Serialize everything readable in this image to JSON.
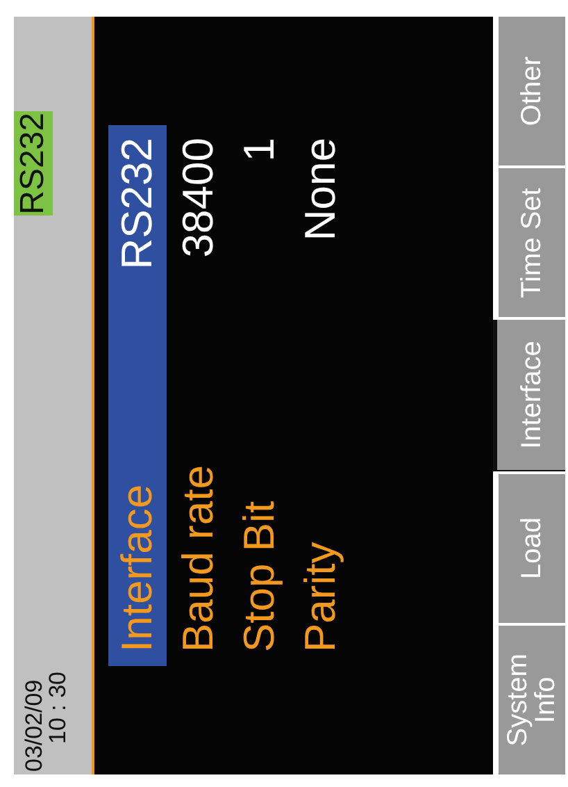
{
  "status": {
    "date": "03/02/09",
    "time": "10 : 30",
    "badge": "RS232"
  },
  "settings": [
    {
      "label": "Interface",
      "value": "RS232",
      "selected": true
    },
    {
      "label": "Baud rate",
      "value": "38400",
      "selected": false
    },
    {
      "label": "Stop Bit",
      "value": "1",
      "selected": false
    },
    {
      "label": "Parity",
      "value": "None",
      "selected": false
    }
  ],
  "tabs": [
    {
      "label": "System Info",
      "selected": false
    },
    {
      "label": "Load",
      "selected": false
    },
    {
      "label": "Interface",
      "selected": true
    },
    {
      "label": "Time Set",
      "selected": false
    },
    {
      "label": "Other",
      "selected": false
    }
  ]
}
